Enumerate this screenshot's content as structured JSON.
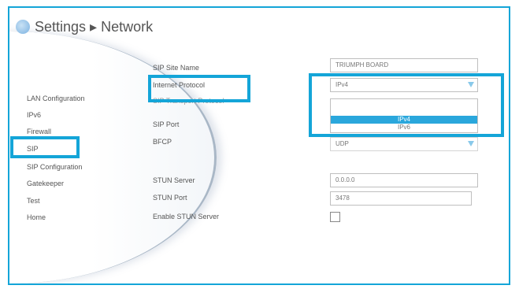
{
  "header": {
    "title": "Settings ▸ Network"
  },
  "sidebar": {
    "items": [
      {
        "label": "LAN Configuration"
      },
      {
        "label": "IPv6"
      },
      {
        "label": "Firewall"
      },
      {
        "label": "SIP"
      },
      {
        "label": "SIP Configuration"
      },
      {
        "label": "Gatekeeper"
      },
      {
        "label": "Test"
      },
      {
        "label": "Home"
      }
    ]
  },
  "form": {
    "sip_site_name": {
      "label": "SIP Site Name",
      "value": "TRIUMPH BOARD"
    },
    "internet_protocol": {
      "label": "Internet Protocol",
      "value": "IPv4",
      "options": [
        "IPv4",
        "IPv6"
      ]
    },
    "sip_transport_protocol": {
      "label": "SIP Transport Protocol"
    },
    "sip_port": {
      "label": "SIP Port"
    },
    "bfcp": {
      "label": "BFCP",
      "value": "UDP"
    },
    "stun_server": {
      "label": "STUN Server",
      "value": "0.0.0.0"
    },
    "stun_port": {
      "label": "STUN Port",
      "value": "3478"
    },
    "enable_stun_server": {
      "label": "Enable STUN Server",
      "checked": false
    }
  },
  "colors": {
    "accent": "#14a5d8",
    "selected_option": "#2aa7dc"
  }
}
